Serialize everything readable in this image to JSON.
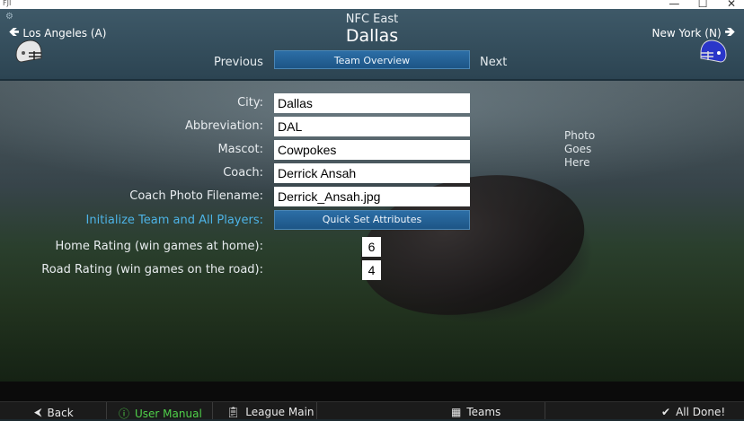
{
  "window": {
    "app_icon": "FJI",
    "minimize": "—",
    "maximize": "☐",
    "close": "✕"
  },
  "header": {
    "conference": "NFC East",
    "team": "Dallas",
    "left_team": "Los Angeles (A)",
    "right_team": "New York (N)",
    "previous": "Previous",
    "next": "Next",
    "tab": "Team Overview",
    "left_helmet_color": "#e6e6e6",
    "right_helmet_color": "#2a36c9"
  },
  "form": {
    "city_label": "City:",
    "city": "Dallas",
    "abbr_label": "Abbreviation:",
    "abbr": "DAL",
    "mascot_label": "Mascot:",
    "mascot": "Cowpokes",
    "coach_label": "Coach:",
    "coach": "Derrick Ansah",
    "photo_label": "Coach Photo Filename:",
    "photo": "Derrick_Ansah.jpg",
    "init_label": "Initialize Team and All Players:",
    "quick_set": "Quick Set Attributes",
    "home_label": "Home Rating (win games at home):",
    "home": "6",
    "road_label": "Road Rating (win games on the road):",
    "road": "4"
  },
  "photo_placeholder": {
    "line1": "Photo",
    "line2": "Goes",
    "line3": "Here"
  },
  "bottom": {
    "back": "Back",
    "manual": "User Manual",
    "league": "League Main",
    "teams": "Teams",
    "done": "All Done!"
  }
}
